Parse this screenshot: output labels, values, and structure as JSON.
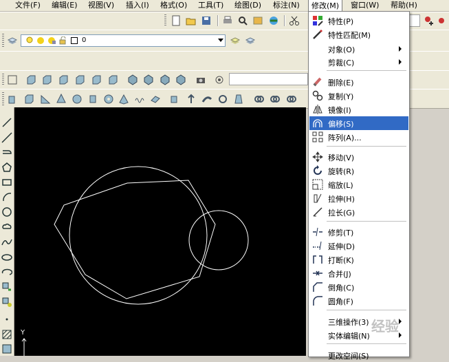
{
  "menubar": {
    "items": [
      {
        "label": "文件(F)"
      },
      {
        "label": "编辑(E)"
      },
      {
        "label": "视图(V)"
      },
      {
        "label": "插入(I)"
      },
      {
        "label": "格式(O)"
      },
      {
        "label": "工具(T)"
      },
      {
        "label": "绘图(D)"
      },
      {
        "label": "标注(N)"
      },
      {
        "label": "修改(M)",
        "active": true
      },
      {
        "label": "窗口(W)"
      },
      {
        "label": "帮助(H)"
      }
    ]
  },
  "layer": {
    "current_name": "0"
  },
  "modify_menu": {
    "items": [
      {
        "label": "特性(P)",
        "icon": "properties-icon"
      },
      {
        "label": "特性匹配(M)",
        "icon": "match-properties-icon"
      },
      {
        "label": "对象(O)",
        "submenu": true
      },
      {
        "label": "剪裁(C)",
        "submenu": true
      },
      {
        "label": "删除(E)",
        "icon": "erase-icon"
      },
      {
        "label": "复制(Y)",
        "icon": "copy-icon"
      },
      {
        "label": "镜像(I)",
        "icon": "mirror-icon"
      },
      {
        "label": "偏移(S)",
        "icon": "offset-icon",
        "highlighted": true
      },
      {
        "label": "阵列(A)...",
        "icon": "array-icon"
      },
      {
        "label": "移动(V)",
        "icon": "move-icon"
      },
      {
        "label": "旋转(R)",
        "icon": "rotate-icon"
      },
      {
        "label": "缩放(L)",
        "icon": "scale-icon"
      },
      {
        "label": "拉伸(H)",
        "icon": "stretch-icon"
      },
      {
        "label": "拉长(G)",
        "icon": "lengthen-icon"
      },
      {
        "label": "修剪(T)",
        "icon": "trim-icon"
      },
      {
        "label": "延伸(D)",
        "icon": "extend-icon"
      },
      {
        "label": "打断(K)",
        "icon": "break-icon"
      },
      {
        "label": "合并(J)",
        "icon": "join-icon"
      },
      {
        "label": "倒角(C)",
        "icon": "chamfer-icon"
      },
      {
        "label": "圆角(F)",
        "icon": "fillet-icon"
      },
      {
        "label": "三维操作(3)",
        "submenu": true
      },
      {
        "label": "实体编辑(N)",
        "submenu": true
      },
      {
        "label": "更改空间(S)"
      }
    ]
  },
  "ucs": {
    "axis_label": "Y"
  },
  "watermark": {
    "text": "经验"
  },
  "colors": {
    "canvas": "#000000",
    "highlight": "#316ac5",
    "menubar": "#ece9d8"
  }
}
